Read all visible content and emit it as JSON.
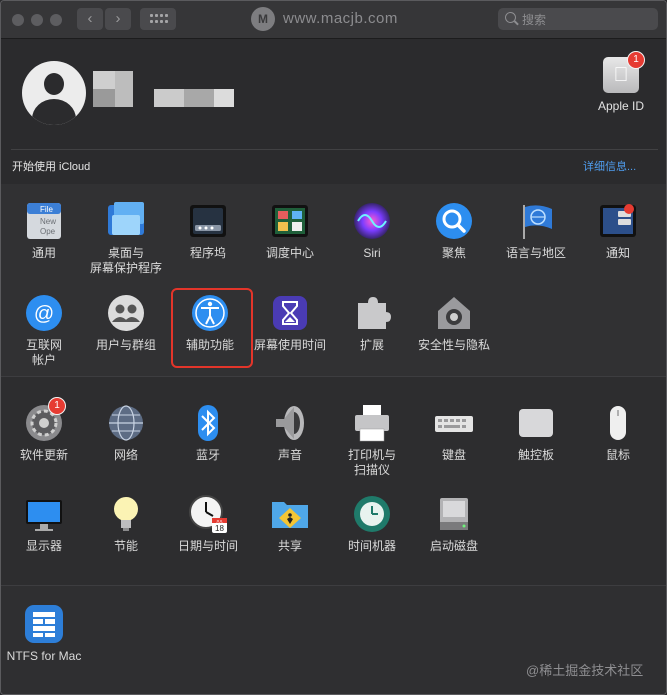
{
  "window": {
    "watermark": "www.macjb.com",
    "watermark_logo": "M",
    "search_placeholder": "搜索",
    "nav_back": "‹",
    "nav_forward": "›"
  },
  "header": {
    "apple_id_label": "Apple ID",
    "apple_id_badge": "1",
    "icloud_prompt": "开始使用 iCloud",
    "details_link": "详细信息..."
  },
  "panes": [
    {
      "id": "general",
      "label": "通用",
      "icon": "general-icon"
    },
    {
      "id": "desktop",
      "label": "桌面与\n屏幕保护程序",
      "icon": "desktop-screensaver-icon"
    },
    {
      "id": "dock",
      "label": "程序坞",
      "icon": "dock-icon"
    },
    {
      "id": "mission",
      "label": "调度中心",
      "icon": "mission-control-icon"
    },
    {
      "id": "siri",
      "label": "Siri",
      "icon": "siri-icon"
    },
    {
      "id": "spotlight",
      "label": "聚焦",
      "icon": "spotlight-icon"
    },
    {
      "id": "language",
      "label": "语言与地区",
      "icon": "language-region-icon"
    },
    {
      "id": "notifications",
      "label": "通知",
      "icon": "notifications-icon"
    },
    {
      "id": "internet",
      "label": "互联网\n帐户",
      "icon": "internet-accounts-icon"
    },
    {
      "id": "users",
      "label": "用户与群组",
      "icon": "users-groups-icon"
    },
    {
      "id": "accessibility",
      "label": "辅助功能",
      "icon": "accessibility-icon",
      "selected": true
    },
    {
      "id": "screentime",
      "label": "屏幕使用时间",
      "icon": "screen-time-icon"
    },
    {
      "id": "extensions",
      "label": "扩展",
      "icon": "extensions-icon"
    },
    {
      "id": "security",
      "label": "安全性与隐私",
      "icon": "security-privacy-icon"
    },
    {
      "id": "software",
      "label": "软件更新",
      "icon": "software-update-icon",
      "badge": "1"
    },
    {
      "id": "network",
      "label": "网络",
      "icon": "network-icon"
    },
    {
      "id": "bluetooth",
      "label": "蓝牙",
      "icon": "bluetooth-icon"
    },
    {
      "id": "sound",
      "label": "声音",
      "icon": "sound-icon"
    },
    {
      "id": "printers",
      "label": "打印机与\n扫描仪",
      "icon": "printers-scanners-icon"
    },
    {
      "id": "keyboard",
      "label": "键盘",
      "icon": "keyboard-icon"
    },
    {
      "id": "trackpad",
      "label": "触控板",
      "icon": "trackpad-icon"
    },
    {
      "id": "mouse",
      "label": "鼠标",
      "icon": "mouse-icon"
    },
    {
      "id": "displays",
      "label": "显示器",
      "icon": "displays-icon"
    },
    {
      "id": "energy",
      "label": "节能",
      "icon": "energy-saver-icon"
    },
    {
      "id": "datetime",
      "label": "日期与时间",
      "icon": "date-time-icon",
      "calendar_day": "18",
      "calendar_month": "JUL"
    },
    {
      "id": "sharing",
      "label": "共享",
      "icon": "sharing-icon"
    },
    {
      "id": "timemachine",
      "label": "时间机器",
      "icon": "time-machine-icon"
    },
    {
      "id": "startup",
      "label": "启动磁盘",
      "icon": "startup-disk-icon"
    },
    {
      "id": "ntfs",
      "label": "NTFS for Mac",
      "icon": "ntfs-for-mac-icon"
    }
  ],
  "general_icon_text": [
    "File",
    "New",
    "Ope"
  ],
  "footer_watermark": "@稀土掘金技术社区",
  "colors": {
    "accent_link": "#4f9ef0",
    "selection_outline": "#e3352a",
    "badge": "#e63b32"
  }
}
